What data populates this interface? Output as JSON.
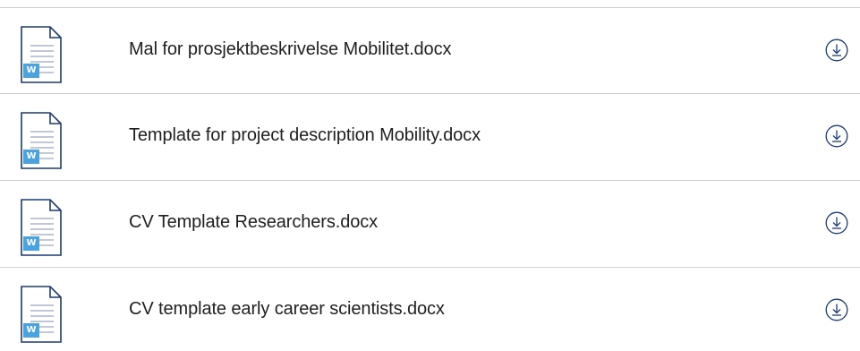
{
  "files": [
    {
      "name": "Mal for prosjektbeskrivelse Mobilitet.docx",
      "icon": "word-document-icon",
      "action_icon": "download-icon"
    },
    {
      "name": "Template for project description Mobility.docx",
      "icon": "word-document-icon",
      "action_icon": "download-icon"
    },
    {
      "name": "CV Template Researchers.docx",
      "icon": "word-document-icon",
      "action_icon": "download-icon"
    },
    {
      "name": "CV template early career scientists.docx",
      "icon": "word-document-icon",
      "action_icon": "download-icon"
    }
  ],
  "icon_badge_letter": "W",
  "colors": {
    "word_badge": "#4aa3df",
    "download_accent": "#1c3a78",
    "divider": "#cfcfcf",
    "doc_outline": "#1c3a78"
  }
}
